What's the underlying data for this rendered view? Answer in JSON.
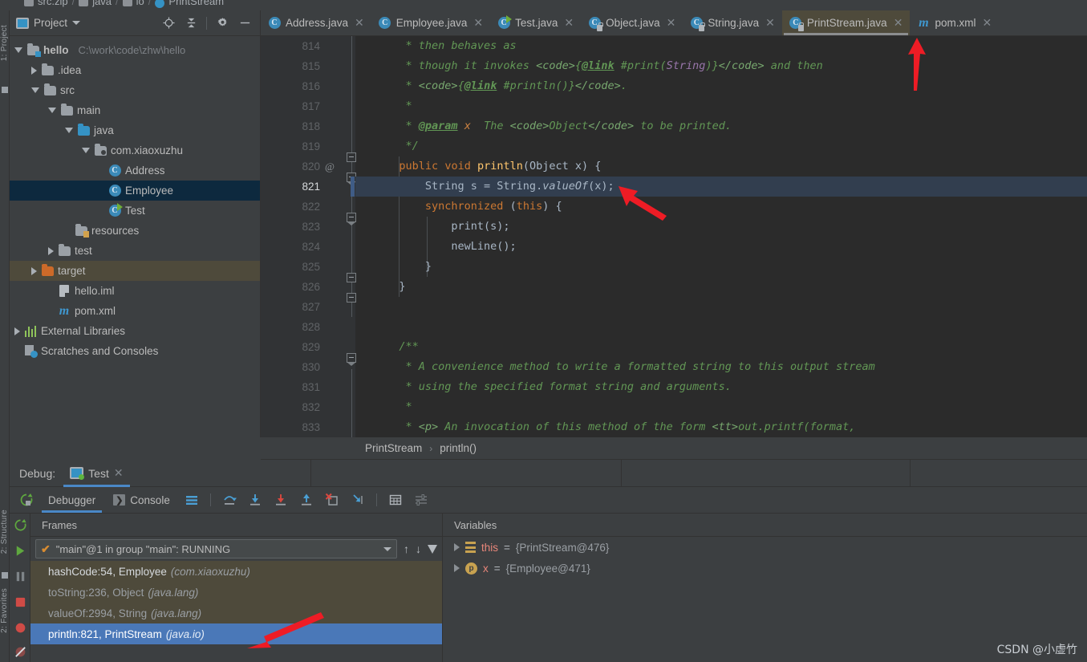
{
  "top_breadcrumb": {
    "items": [
      "src.zip",
      "java",
      "io",
      "PrintStream"
    ]
  },
  "rail": {
    "project": "1: Project",
    "structure": "2: Structure",
    "favorites": "2: Favorites"
  },
  "project_panel": {
    "title": "Project",
    "tools": [
      "locate-icon",
      "collapse-all-icon",
      "settings-icon",
      "hide-icon"
    ],
    "tree": [
      {
        "label": "hello",
        "detail": "C:\\work\\code\\zhw\\hello",
        "icon": "module-folder",
        "twisty": "down",
        "indent": 0,
        "state": "normal",
        "bold": true
      },
      {
        "label": ".idea",
        "detail": "",
        "icon": "folder",
        "twisty": "right",
        "indent": 1,
        "state": "normal",
        "bold": false
      },
      {
        "label": "src",
        "detail": "",
        "icon": "folder",
        "twisty": "down",
        "indent": 1,
        "state": "normal",
        "bold": false
      },
      {
        "label": "main",
        "detail": "",
        "icon": "folder",
        "twisty": "down",
        "indent": 2,
        "state": "normal",
        "bold": false
      },
      {
        "label": "java",
        "detail": "",
        "icon": "source-folder",
        "twisty": "down",
        "indent": 3,
        "state": "normal",
        "bold": false
      },
      {
        "label": "com.xiaoxuzhu",
        "detail": "",
        "icon": "package-folder",
        "twisty": "down",
        "indent": 4,
        "state": "normal",
        "bold": false
      },
      {
        "label": "Address",
        "detail": "",
        "icon": "class",
        "twisty": "none",
        "indent": 5,
        "state": "normal",
        "bold": false
      },
      {
        "label": "Employee",
        "detail": "",
        "icon": "class",
        "twisty": "none",
        "indent": 5,
        "state": "selected",
        "bold": false
      },
      {
        "label": "Test",
        "detail": "",
        "icon": "class-runnable",
        "twisty": "none",
        "indent": 5,
        "state": "normal",
        "bold": false
      },
      {
        "label": "resources",
        "detail": "",
        "icon": "resource-folder",
        "twisty": "none",
        "indent": 3,
        "state": "normal",
        "bold": false
      },
      {
        "label": "test",
        "detail": "",
        "icon": "folder",
        "twisty": "right",
        "indent": 2,
        "state": "normal",
        "bold": false
      },
      {
        "label": "target",
        "detail": "",
        "icon": "excluded-folder",
        "twisty": "right",
        "indent": 1,
        "state": "highlighted",
        "bold": false
      },
      {
        "label": "hello.iml",
        "detail": "",
        "icon": "iml-file",
        "twisty": "none",
        "indent": 2,
        "state": "normal",
        "bold": false
      },
      {
        "label": "pom.xml",
        "detail": "",
        "icon": "maven-file",
        "twisty": "none",
        "indent": 2,
        "state": "normal",
        "bold": false
      },
      {
        "label": "External Libraries",
        "detail": "",
        "icon": "libraries",
        "twisty": "right",
        "indent": 0,
        "state": "normal",
        "bold": false
      },
      {
        "label": "Scratches and Consoles",
        "detail": "",
        "icon": "scratches",
        "twisty": "none",
        "indent": 0,
        "state": "normal",
        "bold": false
      }
    ]
  },
  "editor_tabs": [
    {
      "label": "Address.java",
      "icon": "java-class-icon",
      "active": false,
      "closable": true
    },
    {
      "label": "Employee.java",
      "icon": "java-class-icon",
      "active": false,
      "closable": true
    },
    {
      "label": "Test.java",
      "icon": "java-runnable-icon",
      "active": false,
      "closable": true
    },
    {
      "label": "Object.java",
      "icon": "java-readonly-icon",
      "active": false,
      "closable": true
    },
    {
      "label": "String.java",
      "icon": "java-readonly-icon",
      "active": false,
      "closable": true
    },
    {
      "label": "PrintStream.java",
      "icon": "java-readonly-icon",
      "active": true,
      "closable": true
    },
    {
      "label": "pom.xml",
      "icon": "maven-file-icon",
      "active": false,
      "closable": true
    }
  ],
  "code": {
    "current_line": 821,
    "lines": [
      {
        "no": 814,
        "segments": [
          {
            "t": "    * then behaves as",
            "c": "cm"
          }
        ]
      },
      {
        "no": 815,
        "segments": [
          {
            "t": "    * though it invokes ",
            "c": "cm"
          },
          {
            "t": "<code>",
            "c": "tagc"
          },
          {
            "t": "{",
            "c": "cm"
          },
          {
            "t": "@link",
            "c": "link"
          },
          {
            "t": " #print(",
            "c": "cm"
          },
          {
            "t": "String",
            "c": "str"
          },
          {
            "t": ")}",
            "c": "cm"
          },
          {
            "t": "</code>",
            "c": "tagc"
          },
          {
            "t": " and then",
            "c": "cm"
          }
        ]
      },
      {
        "no": 816,
        "segments": [
          {
            "t": "    * ",
            "c": "cm"
          },
          {
            "t": "<code>",
            "c": "tagc"
          },
          {
            "t": "{",
            "c": "cm"
          },
          {
            "t": "@link",
            "c": "link"
          },
          {
            "t": " #println()}",
            "c": "cm"
          },
          {
            "t": "</code>",
            "c": "tagc"
          },
          {
            "t": ".",
            "c": "cm"
          }
        ]
      },
      {
        "no": 817,
        "segments": [
          {
            "t": "    *",
            "c": "cm"
          }
        ]
      },
      {
        "no": 818,
        "segments": [
          {
            "t": "    * ",
            "c": "cm"
          },
          {
            "t": "@param",
            "c": "link"
          },
          {
            "t": " ",
            "c": "cm"
          },
          {
            "t": "x",
            "c": "par"
          },
          {
            "t": "  The ",
            "c": "cm"
          },
          {
            "t": "<code>",
            "c": "tagc"
          },
          {
            "t": "Object",
            "c": "cm"
          },
          {
            "t": "</code>",
            "c": "tagc"
          },
          {
            "t": " to be printed.",
            "c": "cm"
          }
        ]
      },
      {
        "no": 819,
        "segments": [
          {
            "t": "    */",
            "c": "cm"
          }
        ]
      },
      {
        "no": 820,
        "segments": [
          {
            "t": "   ",
            "c": "plain"
          },
          {
            "t": "public",
            "c": "kw"
          },
          {
            "t": " ",
            "c": "plain"
          },
          {
            "t": "void",
            "c": "kw"
          },
          {
            "t": " ",
            "c": "plain"
          },
          {
            "t": "println",
            "c": "mth"
          },
          {
            "t": "(Object x) {",
            "c": "plain"
          }
        ],
        "gutter_at": "@"
      },
      {
        "no": 821,
        "segments": [
          {
            "t": "       String s = String.",
            "c": "plain"
          },
          {
            "t": "valueOf",
            "c": "ital"
          },
          {
            "t": "(x);",
            "c": "plain"
          }
        ]
      },
      {
        "no": 822,
        "segments": [
          {
            "t": "       ",
            "c": "plain"
          },
          {
            "t": "synchronized",
            "c": "kw"
          },
          {
            "t": " (",
            "c": "plain"
          },
          {
            "t": "this",
            "c": "kw"
          },
          {
            "t": ") {",
            "c": "plain"
          }
        ]
      },
      {
        "no": 823,
        "segments": [
          {
            "t": "           print(s);",
            "c": "plain"
          }
        ]
      },
      {
        "no": 824,
        "segments": [
          {
            "t": "           newLine();",
            "c": "plain"
          }
        ]
      },
      {
        "no": 825,
        "segments": [
          {
            "t": "       }",
            "c": "plain"
          }
        ]
      },
      {
        "no": 826,
        "segments": [
          {
            "t": "   }",
            "c": "plain"
          }
        ]
      },
      {
        "no": 827,
        "segments": []
      },
      {
        "no": 828,
        "segments": []
      },
      {
        "no": 829,
        "segments": [
          {
            "t": "   /**",
            "c": "cm"
          }
        ]
      },
      {
        "no": 830,
        "segments": [
          {
            "t": "    * A convenience method to write a formatted string to this output stream",
            "c": "cm"
          }
        ]
      },
      {
        "no": 831,
        "segments": [
          {
            "t": "    * using the specified format string and arguments.",
            "c": "cm"
          }
        ]
      },
      {
        "no": 832,
        "segments": [
          {
            "t": "    *",
            "c": "cm"
          }
        ]
      },
      {
        "no": 833,
        "segments": [
          {
            "t": "    * ",
            "c": "cm"
          },
          {
            "t": "<p>",
            "c": "tagc"
          },
          {
            "t": " An invocation of this method of the form ",
            "c": "cm"
          },
          {
            "t": "<tt>",
            "c": "tagc"
          },
          {
            "t": "out.printf(format,",
            "c": "cm"
          }
        ]
      }
    ]
  },
  "editor_breadcrumb": {
    "class": "PrintStream",
    "separator": "›",
    "method": "println()"
  },
  "debug": {
    "window_label": "Debug:",
    "session_tab": "Test",
    "tabs": [
      {
        "label": "Debugger",
        "icon": "debugger-icon",
        "active": true
      },
      {
        "label": "Console",
        "icon": "console-icon",
        "active": false
      }
    ],
    "toolbar_icons": [
      "layout-icon",
      "step-over-icon",
      "step-into-icon",
      "force-step-into-icon",
      "step-out-icon",
      "drop-frame-icon",
      "run-to-cursor-icon",
      "evaluate-icon",
      "settings-icon"
    ],
    "rail_icons": [
      "rerun-icon",
      "resume-icon",
      "pause-icon",
      "stop-icon",
      "breakpoints-icon",
      "mute-breakpoints-icon"
    ],
    "frames": {
      "header": "Frames",
      "thread": "\"main\"@1 in group \"main\": RUNNING",
      "items": [
        {
          "method": "hashCode:54, Employee",
          "pkg": "(com.xiaoxuzhu)",
          "state": "top"
        },
        {
          "method": "toString:236, Object",
          "pkg": "(java.lang)",
          "state": "dim"
        },
        {
          "method": "valueOf:2994, String",
          "pkg": "(java.lang)",
          "state": "dim"
        },
        {
          "method": "println:821, PrintStream",
          "pkg": "(java.io)",
          "state": "selected"
        }
      ]
    },
    "variables": {
      "header": "Variables",
      "items": [
        {
          "icon": "field-icon",
          "name": "this",
          "eq": " = ",
          "value": "{PrintStream@476}"
        },
        {
          "icon": "param-icon",
          "name": "x",
          "eq": " = ",
          "value": "{Employee@471}"
        }
      ]
    }
  },
  "watermark": "CSDN @小虚竹",
  "colors": {
    "accent_blue": "#4a88c7",
    "selection_navy": "#0d293e",
    "tan_highlight": "#4e4a3b",
    "editor_bg": "#2b2b2b",
    "arrow_red": "#ee1c25"
  }
}
